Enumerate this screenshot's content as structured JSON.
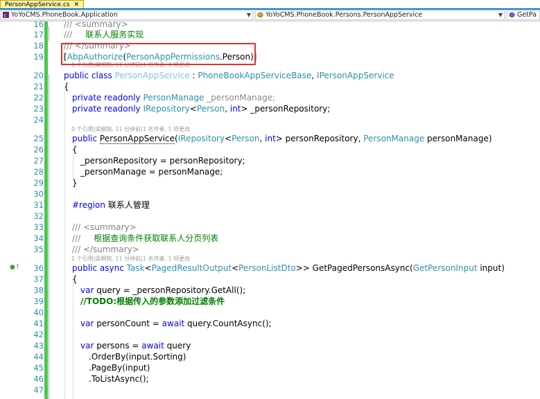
{
  "tab": {
    "title": "PersonAppService.cs",
    "close": "✕"
  },
  "nav": [
    {
      "label": "YoYoCMS.PhoneBook.Application"
    },
    {
      "label": "YoYoCMS.PhoneBook.Persons.PersonAppService"
    },
    {
      "label": "GetPa"
    }
  ],
  "colors": {
    "accent": "#007acc",
    "changebar": "#4ec44e",
    "highlight_box": "#e03030"
  },
  "lines": {
    "l16": {
      "num": "16",
      "a": "/// <summary>"
    },
    "l17": {
      "num": "17",
      "a": "///     联系人服务实现"
    },
    "l18": {
      "num": "18",
      "a": "/// </summary>"
    },
    "l19": {
      "num": "19",
      "a": "[",
      "b": "AbpAuthorize",
      "c": "(",
      "d": "PersonAppPermissions",
      "e": ".Person)]"
    },
    "l19lens": "1 个引用|梁桐铭, 11 分钟前|1 名作者, 1 项更改",
    "l20": {
      "num": "20",
      "a": "public class ",
      "b": "PersonAppService",
      "c": " : ",
      "d": "PhoneBookAppServiceBase",
      "e": ", ",
      "f": "IPersonAppService"
    },
    "l21": {
      "num": "21",
      "a": "{"
    },
    "l22": {
      "num": "22",
      "a": "private readonly ",
      "b": "PersonManage",
      "c": " _personManage;"
    },
    "l23": {
      "num": "23",
      "a": "private readonly ",
      "b": "IRepository",
      "c": "<",
      "d": "Person",
      "e": ", ",
      "f": "int",
      "g": "> _personRepository;"
    },
    "l24": {
      "num": "24"
    },
    "l25lens": "0 个引用|梁桐铭, 11 分钟前|1 名作者, 1 项更改",
    "l25": {
      "num": "25",
      "a": "public ",
      "b": "PersonAppService",
      "c": "(",
      "d": "IRepository",
      "e": "<",
      "f": "Person",
      "g": ", ",
      "h": "int",
      "i": "> personRepository, ",
      "j": "PersonManage",
      "k": " personManage)"
    },
    "l26": {
      "num": "26",
      "a": "{"
    },
    "l27": {
      "num": "27",
      "a": "_personRepository = personRepository;"
    },
    "l28": {
      "num": "28",
      "a": "_personManage = personManage;"
    },
    "l29": {
      "num": "29",
      "a": "}"
    },
    "l30": {
      "num": "30"
    },
    "l31": {
      "num": "31",
      "a": "#region ",
      "b": "联系人管理"
    },
    "l32": {
      "num": "32"
    },
    "l33": {
      "num": "33",
      "a": "/// <summary>"
    },
    "l34": {
      "num": "34",
      "a": "///     根据查询条件获取联系人分页列表"
    },
    "l35": {
      "num": "35",
      "a": "/// </summary>"
    },
    "l36lens": "1 个引用|梁桐铭, 11 分钟前|1 名作者, 1 项更改",
    "l36": {
      "num": "36",
      "a": "public async ",
      "b": "Task",
      "c": "<",
      "d": "PagedResultOutput",
      "e": "<",
      "f": "PersonListDto",
      "g": ">> GetPagedPersonsAsync(",
      "h": "GetPersonInput",
      "i": " input)"
    },
    "l37": {
      "num": "37",
      "a": "{"
    },
    "l38": {
      "num": "38",
      "a": "var",
      "b": " query = _personRepository.GetAll();"
    },
    "l39": {
      "num": "39",
      "a": "//TODO:根据传入的参数添加过滤条件"
    },
    "l40": {
      "num": "40"
    },
    "l41": {
      "num": "41",
      "a": "var",
      "b": " personCount = ",
      "c": "await",
      "d": " query.CountAsync();"
    },
    "l42": {
      "num": "42"
    },
    "l43": {
      "num": "43",
      "a": "var",
      "b": " persons = ",
      "c": "await",
      "d": " query"
    },
    "l44": {
      "num": "44",
      "a": ".OrderBy(input.Sorting)"
    },
    "l45": {
      "num": "45",
      "a": ".PageBy(input)"
    },
    "l46": {
      "num": "46",
      "a": ".ToListAsync();"
    },
    "l47": {
      "num": "47"
    }
  }
}
